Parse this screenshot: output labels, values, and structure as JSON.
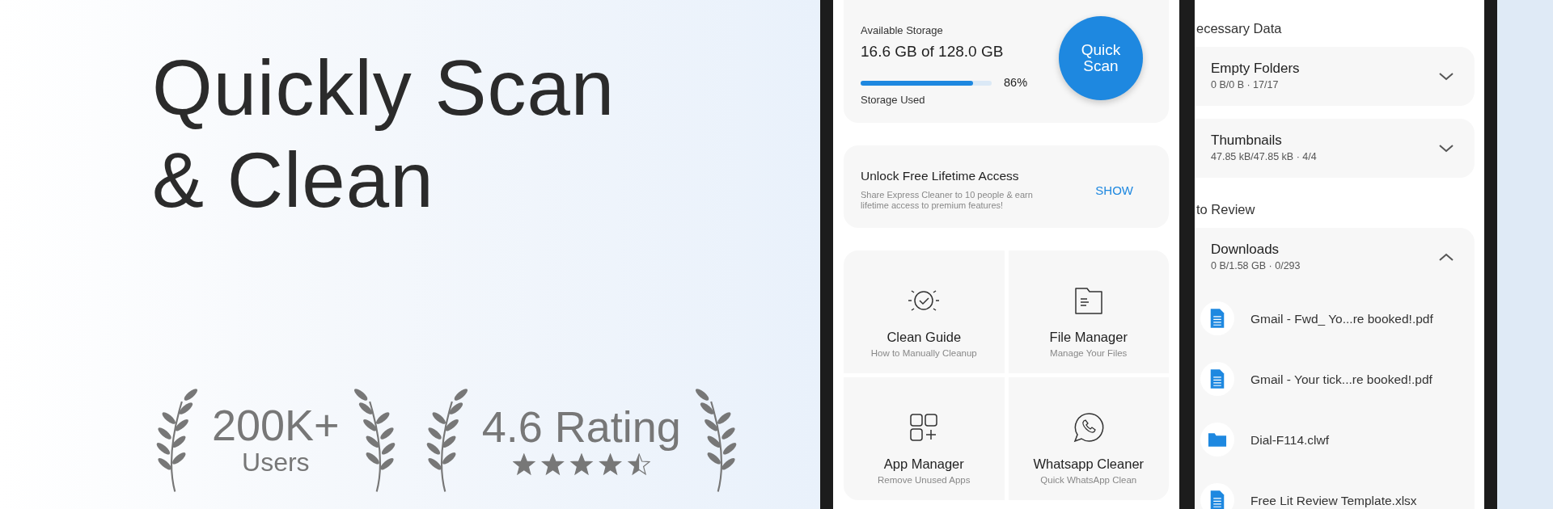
{
  "hero": {
    "title_lines": [
      "Quickly Scan",
      "& Clean"
    ],
    "stats": [
      {
        "kind": "count",
        "value": "200K+",
        "label": "Users"
      },
      {
        "kind": "rating",
        "value": "4.6 Rating",
        "stars": 4.5
      }
    ]
  },
  "home_screen": {
    "storage": {
      "label": "Available Storage",
      "amount": "16.6 GB of 128.0 GB",
      "level": 0.86,
      "percent": "86%",
      "caption": "Storage Used",
      "scan_button": [
        "Quick",
        "Scan"
      ]
    },
    "promo": {
      "title": "Unlock Free Lifetime Access",
      "text": "Share Express Cleaner to 10 people & earn lifetime access to premium features!",
      "action": "SHOW"
    },
    "tools": [
      {
        "title": "Clean Guide",
        "subtitle": "How to Manually Cleanup"
      },
      {
        "title": "File Manager",
        "subtitle": "Manage Your Files"
      },
      {
        "title": "App Manager",
        "subtitle": "Remove Unused Apps"
      },
      {
        "title": "Whatsapp Cleaner",
        "subtitle": "Quick WhatsApp Clean"
      }
    ]
  },
  "review_screen": {
    "sections": [
      {
        "title": "ecessary Data",
        "groups": [
          {
            "title": "Empty Folders",
            "detail": "0 B/0 B · 17/17",
            "expanded": false
          },
          {
            "title": "Thumbnails",
            "detail": "47.85 kB/47.85 kB · 4/4",
            "expanded": false
          }
        ]
      },
      {
        "title": "to Review",
        "groups": [
          {
            "title": "Downloads",
            "detail": "0 B/1.58 GB · 0/293",
            "expanded": true,
            "files": [
              {
                "name": "Gmail - Fwd_ Yo...re booked!.pdf",
                "kind": "document"
              },
              {
                "name": "Gmail - Your tick...re booked!.pdf",
                "kind": "document"
              },
              {
                "name": "Dial-F114.clwf",
                "kind": "folder"
              },
              {
                "name": "Free Lit Review Template.xlsx",
                "kind": "document"
              }
            ]
          }
        ]
      }
    ]
  }
}
